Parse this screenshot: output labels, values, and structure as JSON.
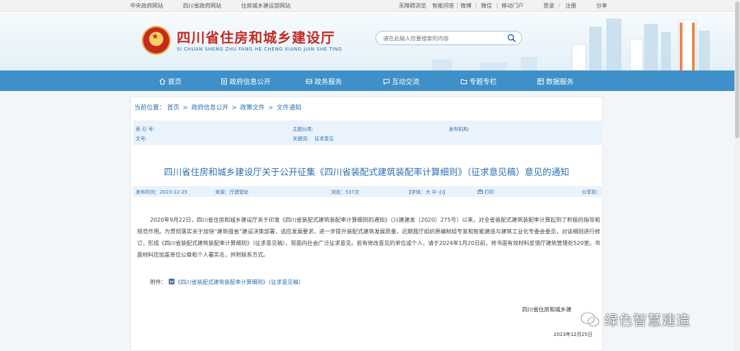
{
  "topbar": {
    "links_left": [
      "中央政府网站",
      "四川省政府网站",
      "住房城乡建设部网站"
    ],
    "links_right": [
      "无障碍浏览",
      "智能问答",
      "微博",
      "微信",
      "移动门户"
    ],
    "login": "登录",
    "register": "注册",
    "share": "分享"
  },
  "header": {
    "title": "四川省住房和城乡建设厅",
    "subtitle": "SI CHUAN SHENG ZHU FANG HE CHENG XIANG JIAN SHE TING",
    "search_placeholder": "请在此输入您要搜索的内容"
  },
  "nav": {
    "items": [
      {
        "label": "首页",
        "icon": "home-icon"
      },
      {
        "label": "政府信息公开",
        "icon": "document-icon"
      },
      {
        "label": "政务服务",
        "icon": "service-icon"
      },
      {
        "label": "互动交流",
        "icon": "chat-icon"
      },
      {
        "label": "专题专栏",
        "icon": "folder-icon"
      },
      {
        "label": "数据服务",
        "icon": "data-icon"
      }
    ]
  },
  "breadcrumb": {
    "label": "当前位置：",
    "items": [
      "首页",
      "政府信息公开",
      "政策文件",
      "文件通知"
    ],
    "separator": ">"
  },
  "meta": {
    "index_no_label": "索 引 号:",
    "doc_no_label": "文号:",
    "category_label": "主题分类:",
    "keywords_label": "关键词:",
    "keywords_value": "征求意见",
    "publisher_label": "发布机构:"
  },
  "article": {
    "title": "四川省住房和城乡建设厅关于公开征集《四川省装配式建筑装配率计算细则》（征求意见稿）意见的通知",
    "publish_time": "发布时间：2023-12-25",
    "source": "来源：厅建管处",
    "views": "浏览：537次",
    "font_size": "【字体：大 中 小】",
    "print": "打印",
    "share": "分享到：",
    "body": "2020年9月22日，四川省住房和城乡建设厅关于印发《四川省装配式建筑装配率计算细则的通知》（川建建发〔2020〕275号）以来，对全省装配式建筑装配率计算起到了积极的指导和规范作用。为贯彻落实关于加快“建筑强省”建设决策部署，适应发展要求，进一步提升装配式建筑发展质量，近期我厅组织原编制组专家和智能建造与建筑工业化专委会委员，对该细则进行修订，形成《四川省装配式建筑装配率计算细则》（征求意见稿），现面向社会广泛征求意见。若有修改意见的单位或个人，请于2024年1月20日前，将书面有效材料反馈厅建筑管理处520室。书面材料应加盖单位公章和个人署实名，并附联系方式。",
    "attachment_label": "附件：",
    "attachment_link": "《四川省装配式建筑装配率计算细则》（征求意见稿）",
    "signer": "四川省住房和城乡建",
    "sign_date": "2023年12月25日"
  },
  "watermark": {
    "text": "绿色智慧建造"
  },
  "colors": {
    "nav": "#3f90c8",
    "link": "#2a6fae",
    "title_red": "#c42a21"
  }
}
